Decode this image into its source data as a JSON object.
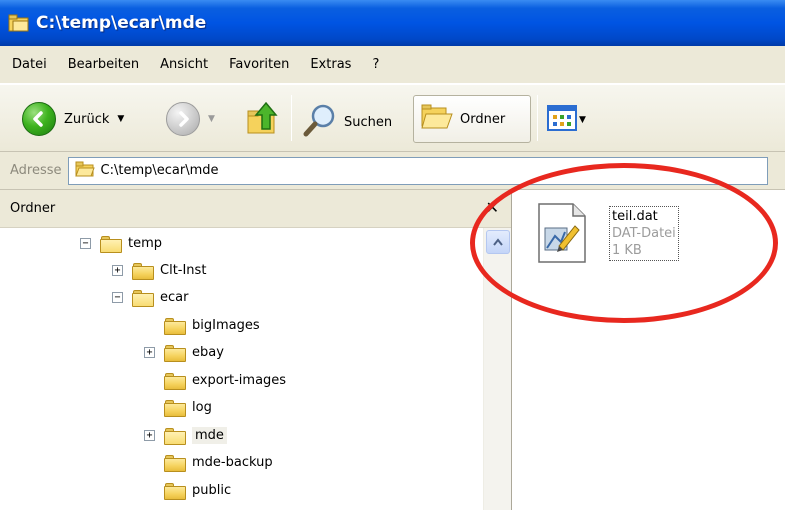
{
  "window": {
    "title": "C:\\temp\\ecar\\mde",
    "title_icon": "folder-window-icon"
  },
  "menu": {
    "items": [
      "Datei",
      "Bearbeiten",
      "Ansicht",
      "Favoriten",
      "Extras",
      "?"
    ]
  },
  "toolbar": {
    "back_label": "Zurück",
    "search_label": "Suchen",
    "folders_label": "Ordner"
  },
  "address": {
    "label": "Adresse",
    "value": "C:\\temp\\ecar\\mde"
  },
  "folder_pane": {
    "header": "Ordner",
    "close_glyph": "✕",
    "tree": [
      {
        "label": "temp",
        "expander": "−",
        "open": true
      },
      {
        "label": "Clt-Inst",
        "expander": "+",
        "open": false
      },
      {
        "label": "ecar",
        "expander": "−",
        "open": true
      },
      {
        "label": "bigImages",
        "expander": "",
        "open": false
      },
      {
        "label": "ebay",
        "expander": "+",
        "open": false
      },
      {
        "label": "export-images",
        "expander": "",
        "open": false
      },
      {
        "label": "log",
        "expander": "",
        "open": false
      },
      {
        "label": "mde",
        "expander": "+",
        "open": true,
        "selected": true
      },
      {
        "label": "mde-backup",
        "expander": "",
        "open": false
      },
      {
        "label": "public",
        "expander": "",
        "open": false
      }
    ]
  },
  "files": [
    {
      "name": "teil.dat",
      "type": "DAT-Datei",
      "size": "1 KB",
      "icon": "generic-file-icon"
    }
  ],
  "colors": {
    "titlebar": "#0054e3",
    "highlight_ellipse": "#e8281f",
    "chrome": "#ece9d8"
  }
}
